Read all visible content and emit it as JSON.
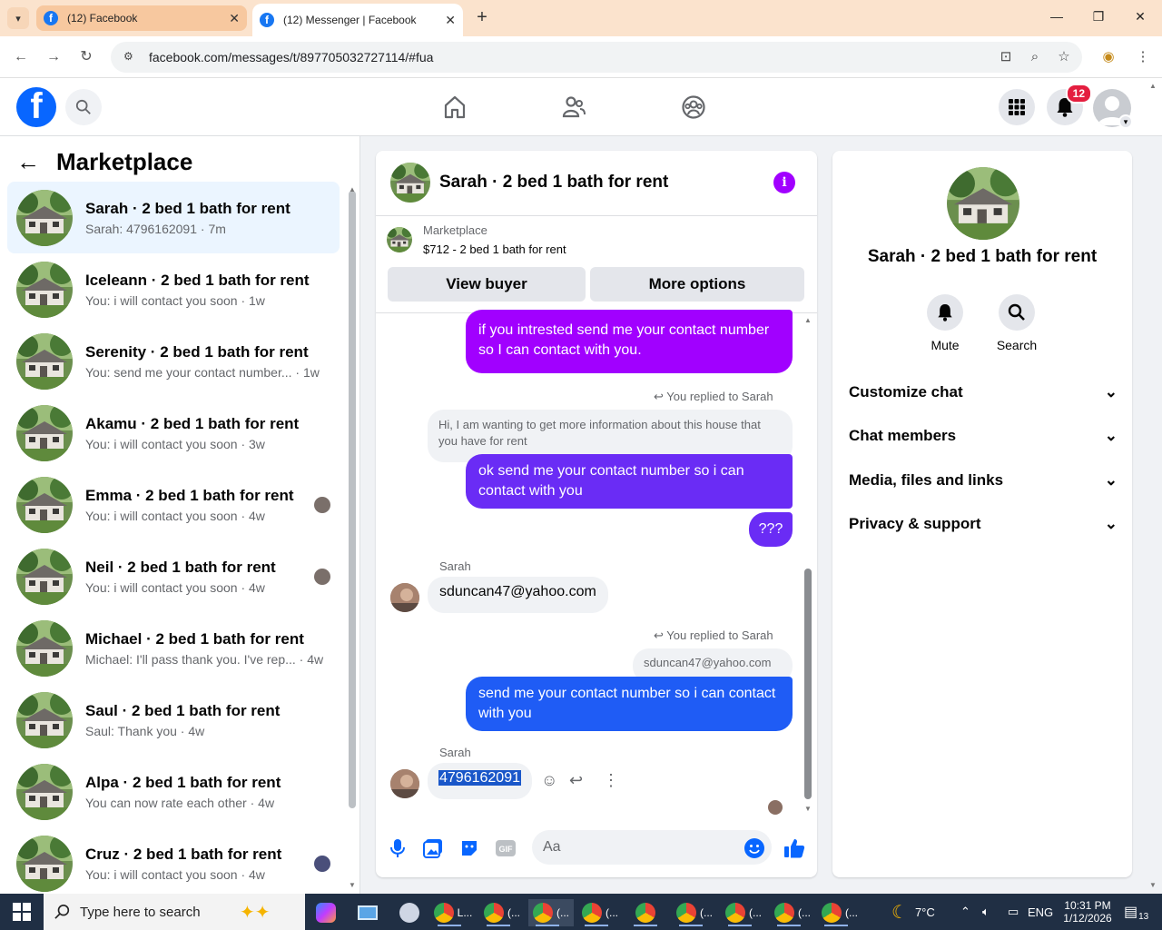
{
  "browser": {
    "tabs": [
      {
        "title": "(12) Facebook",
        "active": false
      },
      {
        "title": "(12) Messenger | Facebook",
        "active": true
      }
    ],
    "url": "facebook.com/messages/t/897705032727114/#fua"
  },
  "fb": {
    "notification_count": "12"
  },
  "sidebar": {
    "title": "Marketplace",
    "items": [
      {
        "name": "Sarah · 2 bed 1 bath for rent",
        "sub": "Sarah: 4796162091 · 7m"
      },
      {
        "name": "Iceleann · 2 bed 1 bath for rent",
        "sub": "You: i will contact you soon · 1w"
      },
      {
        "name": "Serenity · 2 bed 1 bath for rent",
        "sub": "You: send me your contact number... · 1w"
      },
      {
        "name": "Akamu · 2 bed 1 bath for rent",
        "sub": "You: i will contact you soon · 3w"
      },
      {
        "name": "Emma · 2 bed 1 bath for rent",
        "sub": "You: i will contact you soon · 4w"
      },
      {
        "name": "Neil · 2 bed 1 bath for rent",
        "sub": "You: i will contact you soon · 4w"
      },
      {
        "name": "Michael · 2 bed 1 bath for rent",
        "sub": "Michael: I'll pass thank you. I've rep... · 4w"
      },
      {
        "name": "Saul · 2 bed 1 bath for rent",
        "sub": "Saul: Thank you · 4w"
      },
      {
        "name": "Alpa · 2 bed 1 bath for rent",
        "sub": "You can now rate each other · 4w"
      },
      {
        "name": "Cruz · 2 bed 1 bath for rent",
        "sub": "You: i will contact you soon · 4w"
      }
    ]
  },
  "chat": {
    "title": "Sarah · 2 bed 1 bath for rent",
    "marketplace_label": "Marketplace",
    "listing": "$712 - 2 bed 1 bath for rent",
    "view_buyer": "View buyer",
    "more_options": "More options",
    "msg1": "if you intrested send me your contact number so I can contact with you.",
    "reply1": "You replied to Sarah",
    "quote1": "Hi, I am wanting to get more information about this house that you have for rent",
    "msg2": "ok  send me your contact number so i can contact with you",
    "msg3": "???",
    "sender1": "Sarah",
    "msg4": "sduncan47@yahoo.com",
    "reply2": "You replied to Sarah",
    "quote2": "sduncan47@yahoo.com",
    "msg5": "send me your contact number so i can contact with you",
    "sender2": "Sarah",
    "msg6": "4796162091",
    "composer_placeholder": "Aa"
  },
  "rpanel": {
    "name": "Sarah · 2 bed 1 bath for rent",
    "mute": "Mute",
    "search": "Search",
    "rows": [
      "Customize chat",
      "Chat members",
      "Media, files and links",
      "Privacy & support"
    ]
  },
  "taskbar": {
    "search_placeholder": "Type here to search",
    "weather": "7°C",
    "lang": "ENG",
    "time": "10:31 PM",
    "date": "1/12/2026",
    "notif_count": "13",
    "app_label_short": "L...",
    "app_label_dots": "(..."
  },
  "colors": {
    "fb_blue": "#0866ff",
    "purple_bubble": "#a100ff",
    "violet_bubble": "#6a2cf5",
    "blue_bubble": "#1f5cf5"
  }
}
